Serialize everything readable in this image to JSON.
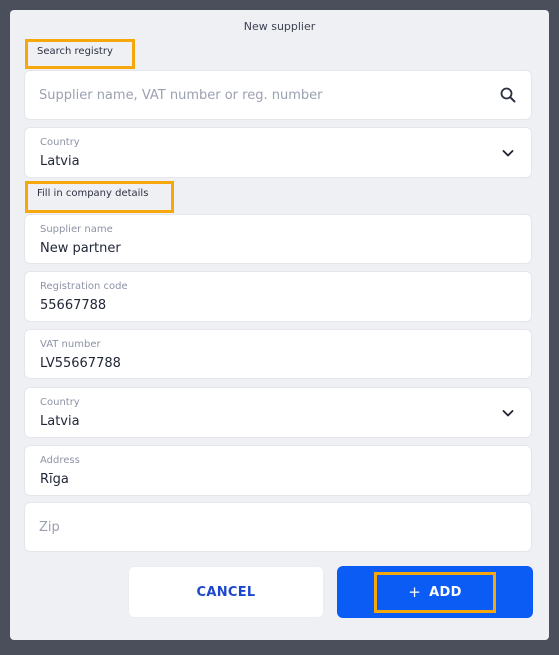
{
  "dialog": {
    "title": "New supplier"
  },
  "search": {
    "section_label": "Search registry",
    "placeholder": "Supplier name, VAT number or reg. number",
    "country_label": "Country",
    "country_value": "Latvia"
  },
  "details": {
    "section_label": "Fill in company details",
    "supplier_name": {
      "label": "Supplier name",
      "value": "New partner"
    },
    "registration_code": {
      "label": "Registration code",
      "value": "55667788"
    },
    "vat_number": {
      "label": "VAT number",
      "value": "LV55667788"
    },
    "country": {
      "label": "Country",
      "value": "Latvia"
    },
    "address": {
      "label": "Address",
      "value": "Rīga"
    },
    "zip": {
      "placeholder": "Zip"
    }
  },
  "actions": {
    "cancel_label": "CANCEL",
    "add_label": "ADD",
    "add_icon": "+"
  },
  "colors": {
    "accent": "#0a5cf4",
    "highlight": "#f5a70c",
    "cancel_text": "#1d47cc"
  },
  "icons": [
    "search-icon",
    "chevron-down-icon",
    "plus-icon"
  ]
}
